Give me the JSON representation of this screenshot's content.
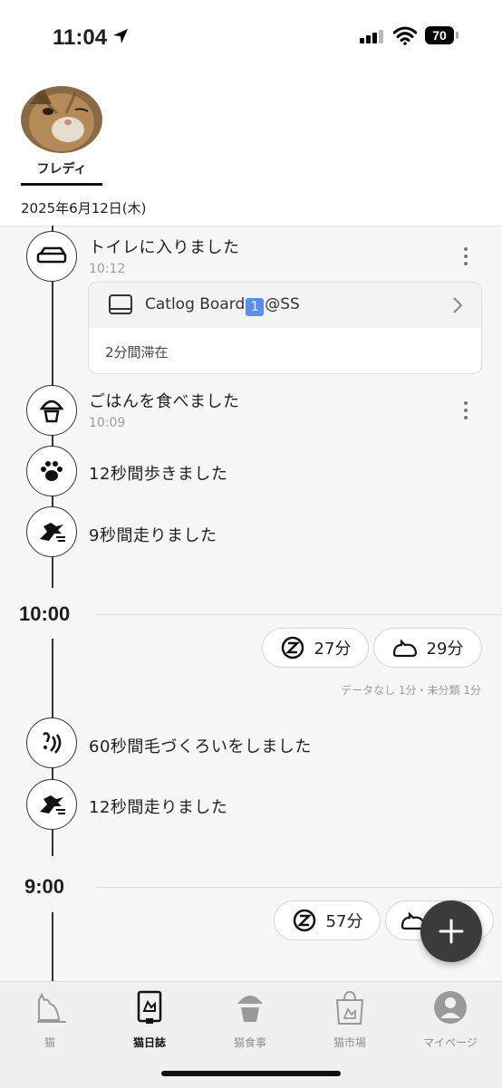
{
  "status_bar": {
    "time": "11:04",
    "battery": "70"
  },
  "profile": {
    "name": "フレディ"
  },
  "date": "2025年6月12日(木)",
  "events_top": [
    {
      "id": "toilet",
      "title": "トイレに入りました",
      "time": "10:12",
      "icon": "litter-box-icon"
    },
    {
      "id": "meal",
      "title": "ごはんを食べました",
      "time": "10:09",
      "icon": "food-bowl-icon"
    },
    {
      "id": "walk",
      "title": "12秒間歩きました",
      "icon": "paw-icon"
    },
    {
      "id": "run1",
      "title": "9秒間走りました",
      "icon": "running-cat-icon"
    }
  ],
  "toilet_card": {
    "board_name": "Catlog Board",
    "board_suffix": "@SS",
    "stay": "2分間滞在"
  },
  "hour_10": {
    "label": "10:00",
    "sleep": "27分",
    "rest": "29分",
    "note": "データなし 1分・未分類 1分"
  },
  "events_mid": [
    {
      "id": "groom",
      "title": "60秒間毛づくろいをしました",
      "icon": "grooming-icon"
    },
    {
      "id": "run2",
      "title": "12秒間走りました",
      "icon": "running-cat-icon"
    }
  ],
  "hour_9": {
    "label": "9:00",
    "sleep": "57分"
  },
  "tabs": [
    {
      "label": "猫",
      "icon": "cat-icon",
      "active": false
    },
    {
      "label": "猫日誌",
      "icon": "diary-icon",
      "active": true
    },
    {
      "label": "猫食事",
      "icon": "food-bowl-icon",
      "active": false
    },
    {
      "label": "猫市場",
      "icon": "shopping-bag-icon",
      "active": false
    },
    {
      "label": "マイページ",
      "icon": "person-icon",
      "active": false
    }
  ]
}
